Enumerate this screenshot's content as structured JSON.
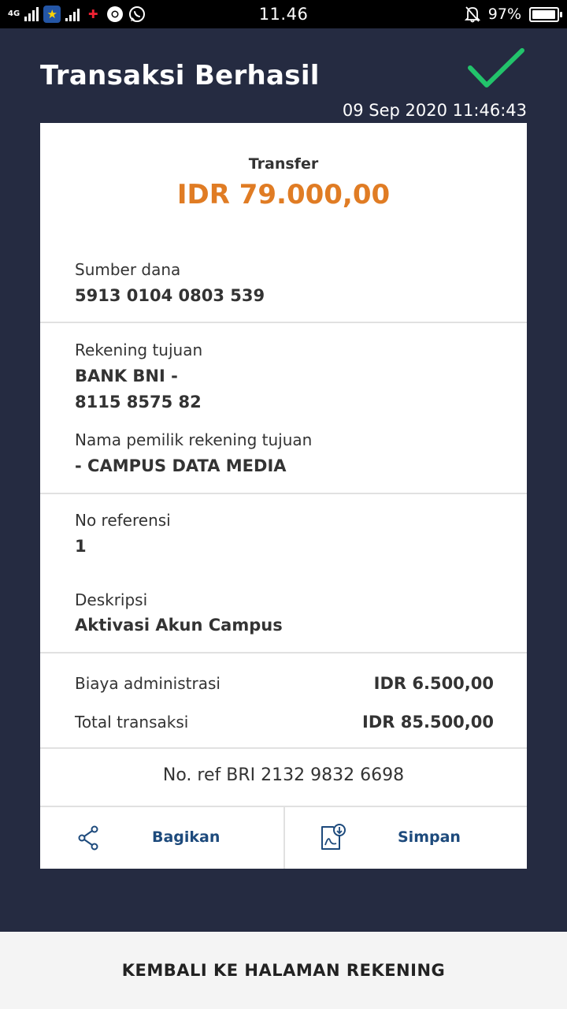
{
  "status_bar": {
    "network": "4G",
    "time": "11.46",
    "battery": "97%",
    "battery_level": 0.97
  },
  "header": {
    "title": "Transaksi Berhasil",
    "timestamp": "09 Sep 2020 11:46:43",
    "status_icon": "check-icon",
    "status_color": "#22c36b"
  },
  "receipt": {
    "type_label": "Transfer",
    "amount": "IDR 79.000,00",
    "amount_color": "#e07c24",
    "source": {
      "label": "Sumber dana",
      "value": "5913 0104 0803 539"
    },
    "destination": {
      "label": "Rekening tujuan",
      "bank": "BANK BNI -",
      "account": "8115 8575 82",
      "owner_label": "Nama pemilik rekening tujuan",
      "owner": "- CAMPUS DATA MEDIA"
    },
    "reference": {
      "label": "No referensi",
      "value": "1"
    },
    "description": {
      "label": "Deskripsi",
      "value": "Aktivasi Akun Campus"
    },
    "fees": {
      "admin_label": "Biaya administrasi",
      "admin_value": "IDR 6.500,00",
      "total_label": "Total transaksi",
      "total_value": "IDR 85.500,00"
    },
    "bri_ref": "No. ref BRI 2132 9832 6698",
    "actions": {
      "share_label": "Bagikan",
      "save_label": "Simpan"
    }
  },
  "footer": {
    "back_label": "KEMBALI KE HALAMAN REKENING"
  },
  "colors": {
    "background": "#252b41",
    "accent": "#1d4a7c"
  }
}
